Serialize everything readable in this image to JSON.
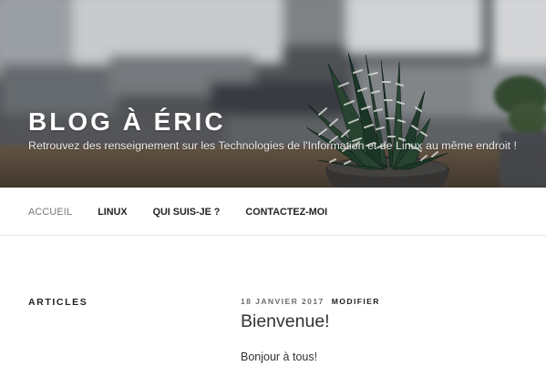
{
  "site": {
    "title": "BLOG À ÉRIC",
    "description": "Retrouvez des renseignement sur les Technologies de l'Information et de Linux au même endroit !"
  },
  "nav": {
    "items": [
      {
        "label": "ACCUEIL",
        "current": true
      },
      {
        "label": "LINUX",
        "current": false
      },
      {
        "label": "QUI SUIS-JE ?",
        "current": false
      },
      {
        "label": "CONTACTEZ-MOI",
        "current": false
      }
    ]
  },
  "sidebar": {
    "title": "ARTICLES"
  },
  "post": {
    "date": "18 JANVIER 2017",
    "edit_label": "MODIFIER",
    "title": "Bienvenue!",
    "excerpt": "Bonjour à tous!"
  },
  "colors": {
    "nav_current": "#767676",
    "text": "#222222",
    "header_text": "#ffffff"
  },
  "header_image": {
    "subject": "succulent-plant-in-pot-blurred-office-background"
  }
}
